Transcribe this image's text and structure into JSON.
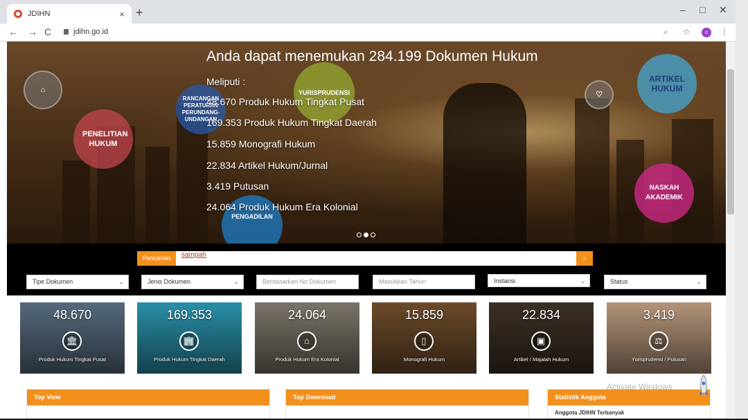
{
  "browser": {
    "tab_title": "JDIHN",
    "tab_close": "×",
    "new_tab": "+",
    "url": "jdihn.go.id",
    "profile_initial": "c",
    "minimize": "–",
    "maximize": "□",
    "close": "✕"
  },
  "hero": {
    "title": "Anda dapat menemukan 284.199 Dokumen Hukum",
    "subtitle": "Meliputi :",
    "items": [
      "48.670 Produk Hukum Tingkat Pusat",
      "169.353 Produk Hukum Tingkat Daerah",
      "15.859 Monografi Hukum",
      "22.834 Artikel Hukum/Jurnal",
      "3.419 Putusan",
      "24.064 Produk Hukum Era Kolonial"
    ],
    "circles": {
      "penelitian": "PENELITIAN HUKUM",
      "rancangan": "RANCANGAN PERATURAN PERUNDANG-UNDANGAN",
      "yurisprudensi": "YURISPRUDENSI",
      "pengadilan": "PENGADILAN",
      "artikel": "ARTIKEL HUKUM",
      "naskah": "NASKAH AKADEMIK"
    }
  },
  "search": {
    "label": "Pencarian",
    "value": "sampah",
    "button_icon": "search-icon"
  },
  "filters": [
    {
      "label": "Tipe Dokumen",
      "placeholder": false,
      "caret": true
    },
    {
      "label": "Jenis Dokumen",
      "placeholder": false,
      "caret": true
    },
    {
      "label": "Berdasarkan No Dokumen",
      "placeholder": true,
      "caret": false
    },
    {
      "label": "Masukkan Tahun",
      "placeholder": true,
      "caret": false
    },
    {
      "label": "Instansi",
      "placeholder": false,
      "caret": true
    },
    {
      "label": "Status",
      "placeholder": false,
      "caret": true
    }
  ],
  "cards": [
    {
      "count": "48.670",
      "label": "Produk Hukum Tingkat Pusat",
      "icon": "building-icon",
      "bg": "#566a7c"
    },
    {
      "count": "169.353",
      "label": "Produk Hukum Tingkat Daerah",
      "icon": "office-icon",
      "bg": "#2a8fa8"
    },
    {
      "count": "24.064",
      "label": "Produk Hukum Era Kolonial",
      "icon": "museum-icon",
      "bg": "#7a7468"
    },
    {
      "count": "15.859",
      "label": "Monografi Hukum",
      "icon": "book-icon",
      "bg": "#6b4a2a"
    },
    {
      "count": "22.834",
      "label": "Artikel / Majalah Hukum",
      "icon": "document-icon",
      "bg": "#3c3024"
    },
    {
      "count": "3.419",
      "label": "Yurisprudensi / Putusan",
      "icon": "justice-icon",
      "bg": "#b29378"
    }
  ],
  "panels": {
    "top_view": "Top View",
    "top_download": "Top Download",
    "statistik": "Statistik Anggota",
    "statistik_row": "Anggota JDIHN Terbanyak"
  },
  "watermark": "Activate Windows"
}
